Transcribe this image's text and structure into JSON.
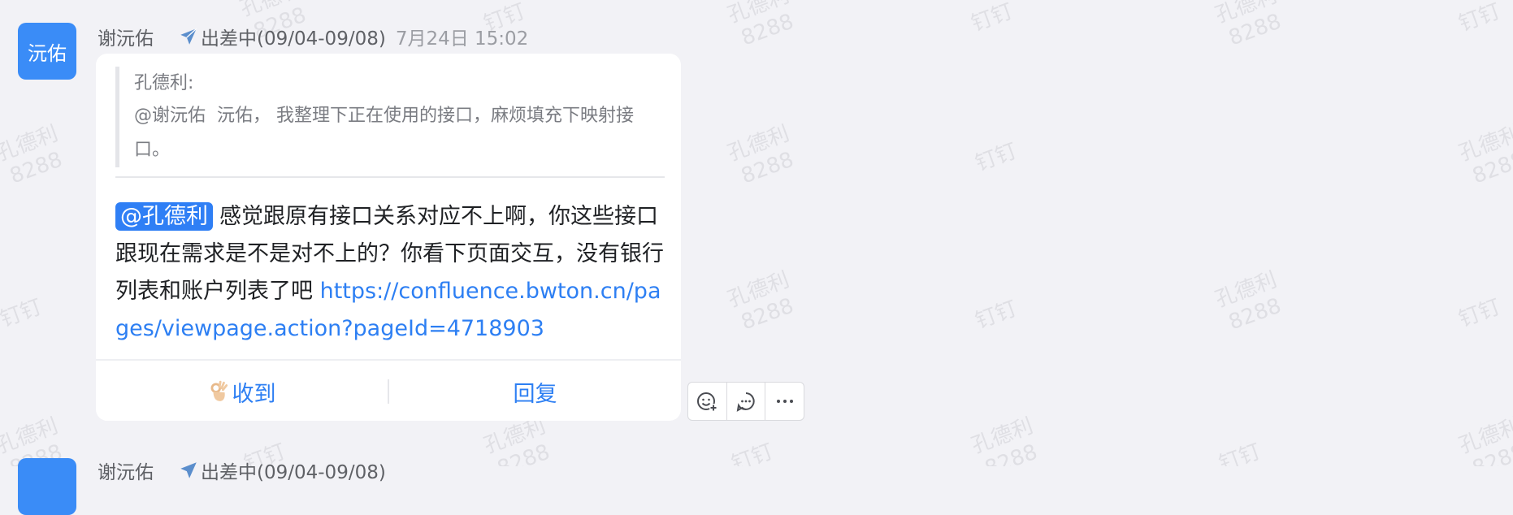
{
  "watermark": {
    "name": "孔德利",
    "number": "8288",
    "alt_text": "钉钉"
  },
  "messages": [
    {
      "avatar_text": "沅佑",
      "sender": "谢沅佑",
      "status": "出差中(09/04-09/08)",
      "timestamp": "7月24日 15:02",
      "quote": {
        "author": "孔德利:",
        "mention": "@谢沅佑",
        "text": "沅佑， 我整理下正在使用的接口，麻烦填充下映射接口。"
      },
      "body": {
        "mention": "@孔德利",
        "text": "感觉跟原有接口关系对应不上啊，你这些接口跟现在需求是不是对不上的？你看下页面交互，没有银行列表和账户列表了吧",
        "link": "https://confluence.bwton.cn/pages/viewpage.action?pageId=4718903"
      },
      "actions": {
        "ack_label": "收到",
        "reply_label": "回复"
      }
    },
    {
      "sender": "谢沅佑",
      "status": "出差中(09/04-09/08)"
    }
  ],
  "toolbar": {
    "icons": [
      "emoji-add-icon",
      "comment-icon",
      "more-icon"
    ]
  },
  "colors": {
    "accent": "#2d7ff3",
    "avatar": "#3a8cf7",
    "background": "#f2f2f6"
  }
}
